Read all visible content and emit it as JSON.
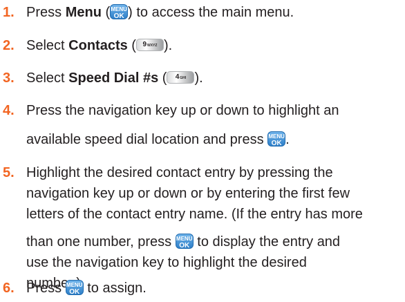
{
  "keys": {
    "menu_line1": "MENU",
    "menu_line2": "OK",
    "nine_digit": "9",
    "nine_letters": "WXYZ",
    "four_digit": "4",
    "four_letters": "GHI"
  },
  "steps": [
    {
      "number": "1.",
      "pre": "Press ",
      "bold": "Menu",
      "paren_open": " (",
      "paren_close": ") to access the main menu."
    },
    {
      "number": "2.",
      "pre": "Select ",
      "bold": "Contacts",
      "paren_open": " (",
      "paren_close": ")."
    },
    {
      "number": "3.",
      "pre": "Select ",
      "bold": "Speed Dial #s",
      "paren_open": " (",
      "paren_close": ")."
    },
    {
      "number": "4.",
      "line1": "Press the navigation key up or down to highlight an",
      "line2_pre": "available speed dial location and press ",
      "line2_post": "."
    },
    {
      "number": "5.",
      "line1": "Highlight the desired contact entry by pressing the",
      "line2": "navigation key up or down or by entering the first few",
      "line3": "letters of the contact entry name. (If the entry has more",
      "line4_pre": "than one number, press ",
      "line4_post": " to display the entry and",
      "line5": "use the navigation key to highlight the desired",
      "line6": "number.)."
    },
    {
      "number": "6.",
      "pre": "Press ",
      "post": " to assign."
    }
  ]
}
